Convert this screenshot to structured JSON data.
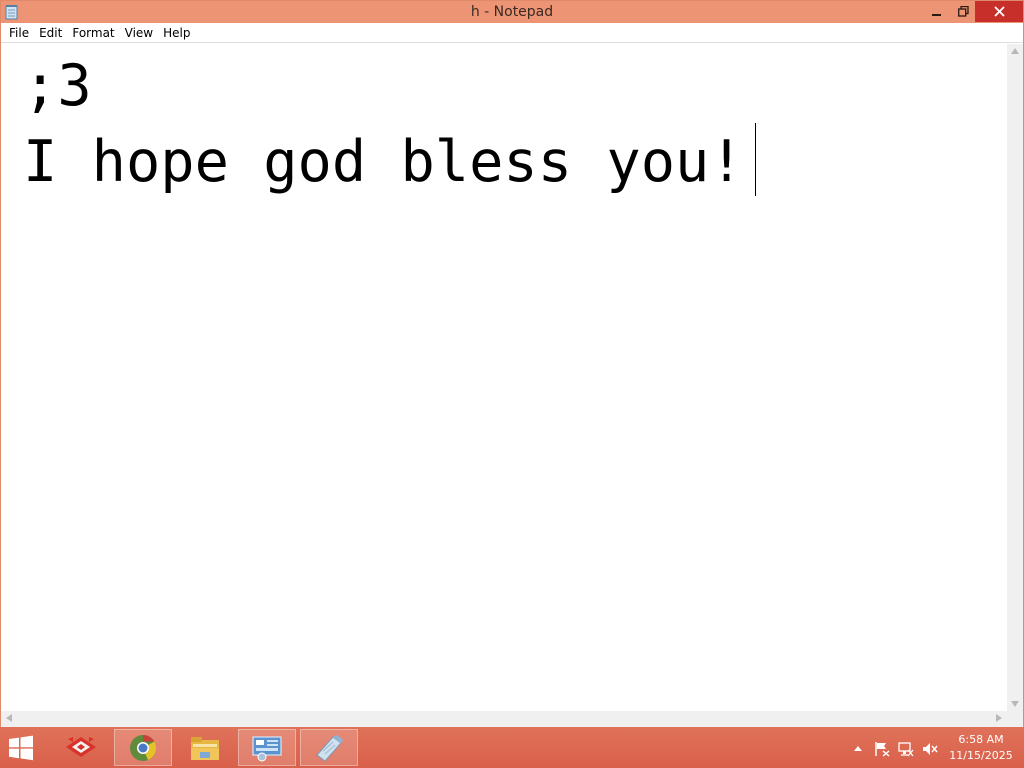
{
  "window": {
    "title": "h - Notepad",
    "app_icon": "notepad-icon",
    "controls": [
      "minimize-icon",
      "maximize-icon",
      "close-icon"
    ]
  },
  "menu": {
    "items": [
      "File",
      "Edit",
      "Format",
      "View",
      "Help"
    ]
  },
  "editor": {
    "lines": [
      ";3",
      "I hope god bless you!"
    ]
  },
  "taskbar": {
    "start_icon": "windows-logo-icon",
    "apps": [
      {
        "name": "app-launcher-icon"
      },
      {
        "name": "chrome-icon"
      },
      {
        "name": "file-explorer-icon"
      },
      {
        "name": "control-panel-icon"
      },
      {
        "name": "notepad-icon",
        "active": true
      }
    ],
    "tray": [
      "show-hidden-icons-icon",
      "action-center-flag-icon",
      "network-icon",
      "volume-muted-icon"
    ],
    "clock": {
      "time": "6:58 AM",
      "date": "11/15/2025"
    }
  },
  "colors": {
    "titlebar": "#ec9473",
    "close_button": "#c7302a",
    "taskbar": "#dc684f"
  }
}
